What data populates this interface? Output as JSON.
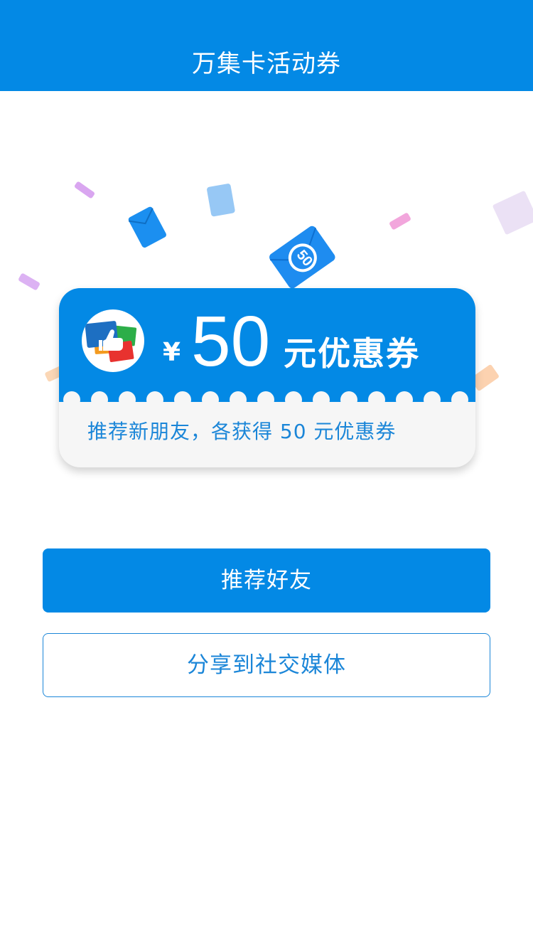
{
  "header": {
    "title": "万集卡活动券"
  },
  "decor": {
    "envelope_badge": "50"
  },
  "coupon": {
    "currency": "¥",
    "amount": "50",
    "type": "元优惠券",
    "description": "推荐新朋友，各获得 50 元优惠券"
  },
  "actions": {
    "recommend_label": "推荐好友",
    "share_label": "分享到社交媒体"
  },
  "colors": {
    "primary": "#0389e5",
    "text_blue": "#1b86d8",
    "coupon_bottom": "#f6f6f6"
  }
}
